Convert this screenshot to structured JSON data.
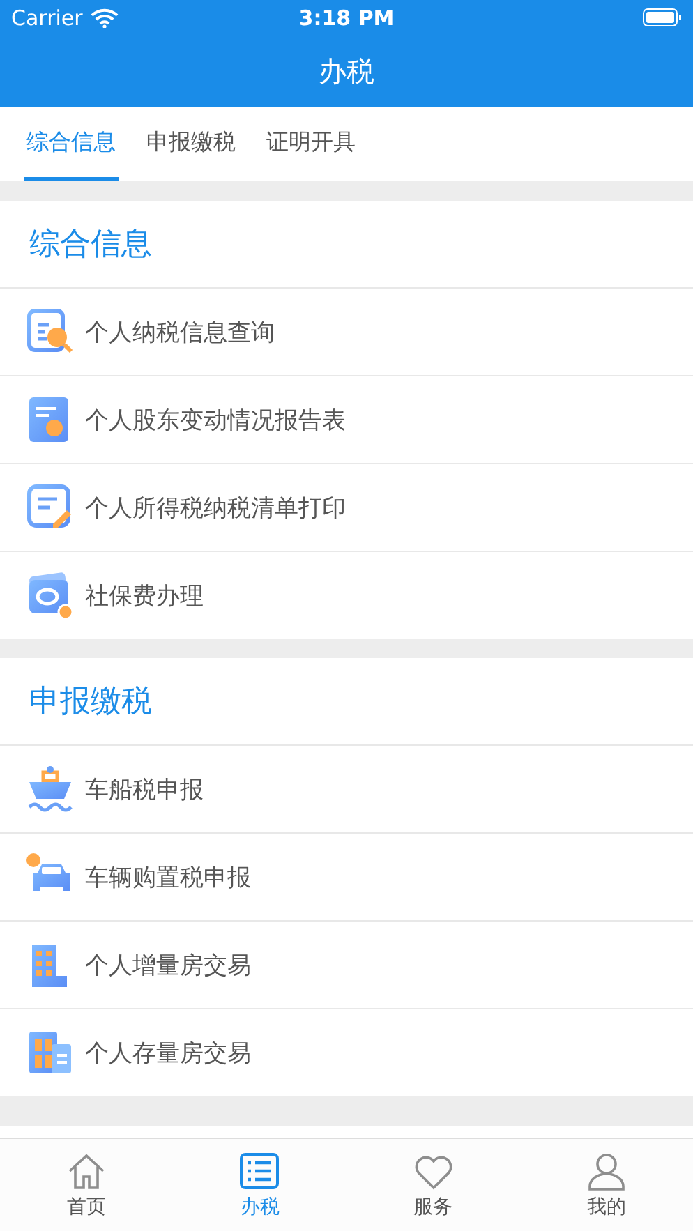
{
  "status_bar": {
    "carrier": "Carrier",
    "time": "3:18 PM"
  },
  "nav": {
    "title": "办税"
  },
  "tabs": [
    {
      "label": "综合信息",
      "selected": true
    },
    {
      "label": "申报缴税",
      "selected": false
    },
    {
      "label": "证明开具",
      "selected": false
    }
  ],
  "sections": [
    {
      "title": "综合信息",
      "items": [
        "个人纳税信息查询",
        "个人股东变动情况报告表",
        "个人所得税纳税清单打印",
        "社保费办理"
      ]
    },
    {
      "title": "申报缴税",
      "items": [
        "车船税申报",
        "车辆购置税申报",
        "个人增量房交易",
        "个人存量房交易"
      ]
    }
  ],
  "tab_bar": [
    {
      "label": "首页",
      "selected": false
    },
    {
      "label": "办税",
      "selected": true
    },
    {
      "label": "服务",
      "selected": false
    },
    {
      "label": "我的",
      "selected": false
    }
  ]
}
